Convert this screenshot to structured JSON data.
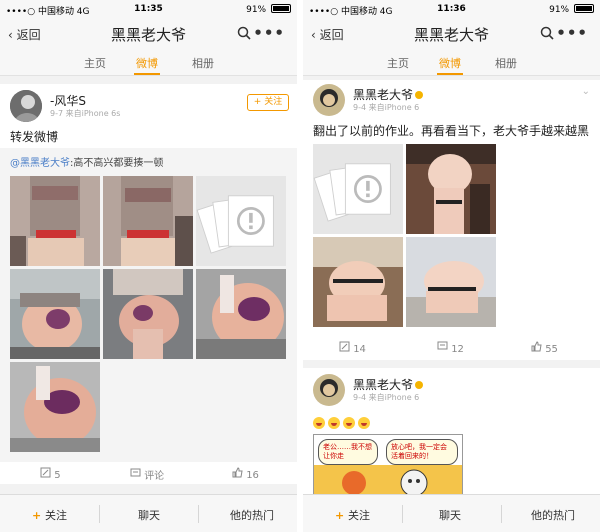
{
  "colors": {
    "accent": "#f39800",
    "link": "#4a7ec7",
    "muted": "#aaaaaa",
    "background": "#f2f2f2"
  },
  "left_phone": {
    "status": {
      "carrier": "••••○ 中国移动 4G",
      "time": "11:35",
      "battery": "91%",
      "battery_level": 0.91
    },
    "nav": {
      "back": "返回",
      "title": "黑黑老大爷",
      "more": "•••"
    },
    "tabs": [
      "主页",
      "微博",
      "相册"
    ],
    "post": {
      "username": "-风华S",
      "meta": "9-7  来自iPhone 6s",
      "follow": "+ 关注",
      "text": "转发微博",
      "repost": {
        "mention": "@黑黑老大爷",
        "text": ":高不高兴都要揍一顿"
      },
      "actions": {
        "repost_count": "5",
        "comment": "评论",
        "like_count": "16"
      }
    },
    "bottom": {
      "follow": "关注",
      "chat": "聊天",
      "hot": "他的热门"
    }
  },
  "right_phone": {
    "status": {
      "carrier": "••••○ 中国移动 4G",
      "time": "11:36",
      "battery": "91%",
      "battery_level": 0.91
    },
    "nav": {
      "back": "返回",
      "title": "黑黑老大爷",
      "more": "•••"
    },
    "tabs": [
      "主页",
      "微博",
      "相册"
    ],
    "post1": {
      "username": "黑黑老大爷",
      "meta": "9-4  来自iPhone 6",
      "text": "翻出了以前的作业。再看看当下，老大爷手越来越黑",
      "actions": {
        "repost_count": "14",
        "comment_count": "12",
        "like_count": "55"
      }
    },
    "post2": {
      "username": "黑黑老大爷",
      "meta": "9-4  来自iPhone 6",
      "comic": {
        "bubble1": "老公……我不想让你走",
        "bubble2": "放心吧，我一定会活着回来的！"
      }
    },
    "bottom": {
      "follow": "关注",
      "chat": "聊天",
      "hot": "他的热门"
    }
  }
}
